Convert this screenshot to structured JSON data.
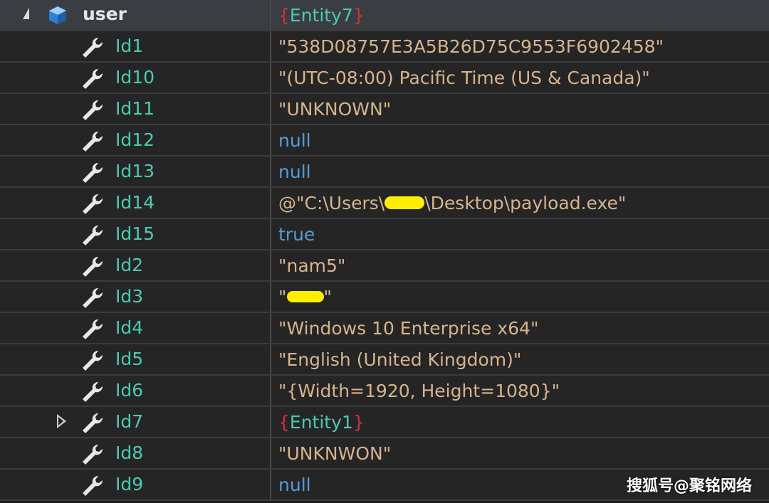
{
  "header": {
    "name": "user",
    "value_open": "{",
    "value_type": "Entity7",
    "value_close": "}"
  },
  "rows": [
    {
      "name": "Id1",
      "value": "\"538D08757E3A5B26D75C9553F6902458\""
    },
    {
      "name": "Id10",
      "value": "\"(UTC-08:00) Pacific Time (US & Canada)\""
    },
    {
      "name": "Id11",
      "value": "\"UNKNOWN\""
    },
    {
      "name": "Id12",
      "value": "null"
    },
    {
      "name": "Id13",
      "value": "null"
    },
    {
      "name": "Id14",
      "value_prefix": "@\"C:\\Users\\",
      "value_suffix": "\\Desktop\\payload.exe\""
    },
    {
      "name": "Id15",
      "value": "true"
    },
    {
      "name": "Id2",
      "value": "\"nam5\""
    },
    {
      "name": "Id3",
      "value_prefix": "\"",
      "value_suffix": "\""
    },
    {
      "name": "Id4",
      "value": "\"Windows 10 Enterprise x64\""
    },
    {
      "name": "Id5",
      "value": "\"English (United Kingdom)\""
    },
    {
      "name": "Id6",
      "value": "\"{Width=1920, Height=1080}\""
    },
    {
      "name": "Id7",
      "value_open": "{",
      "value_type": "Entity1",
      "value_close": "}"
    },
    {
      "name": "Id8",
      "value": "\"UNKNWON\""
    },
    {
      "name": "Id9",
      "value": "null"
    }
  ],
  "watermark": "搜狐号@聚铭网络",
  "colors": {
    "property_name": "#4ec9b0",
    "string_value": "#d6b48d",
    "keyword_value": "#569cd6",
    "brace": "#d0303a",
    "redaction": "#ffee00"
  },
  "icons": [
    "collapse-arrow-icon",
    "object-icon",
    "wrench-icon",
    "expand-arrow-icon"
  ]
}
